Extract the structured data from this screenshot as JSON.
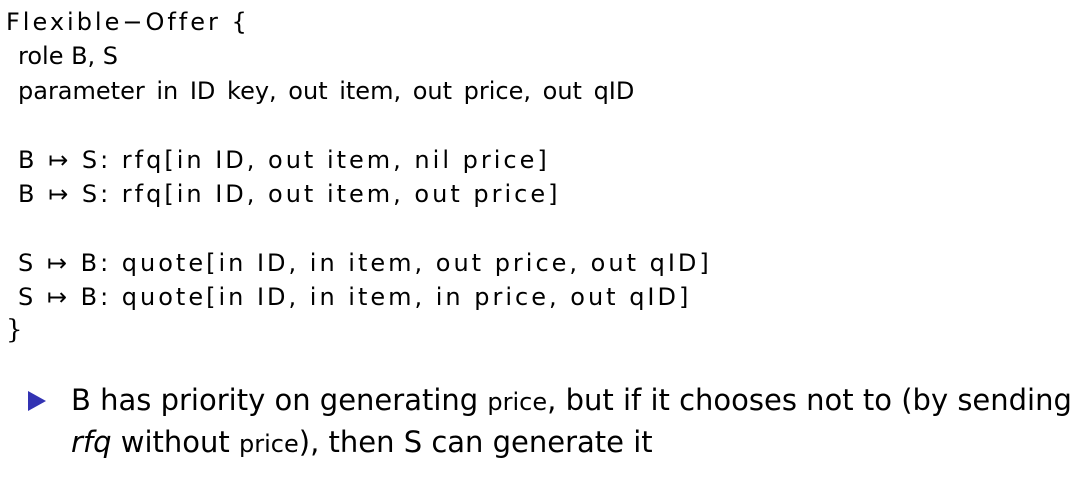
{
  "code": {
    "header": "Flexible−Offer {",
    "role_line": "role B, S",
    "parameter_line": "parameter in ID key, out item, out price, out qID",
    "rfq_1": "B ↦ S: rfq[in ID, out item, nil price]",
    "rfq_2": "B ↦ S: rfq[in ID, out item, out price]",
    "quote_1": "S ↦ B: quote[in ID, in item, out price, out qID]",
    "quote_2": "S ↦ B: quote[in ID, in item, in price, out qID]",
    "closing_brace": "}"
  },
  "bullet": {
    "part1": "B has priority on generating ",
    "price_word_1": "price",
    "part2": ", but if it chooses not to (by sending",
    "rfq_word": "rfq",
    "part3": " without ",
    "price_word_2": "price",
    "part4": "), then S can generate it",
    "marker_color": "#3333b3"
  }
}
